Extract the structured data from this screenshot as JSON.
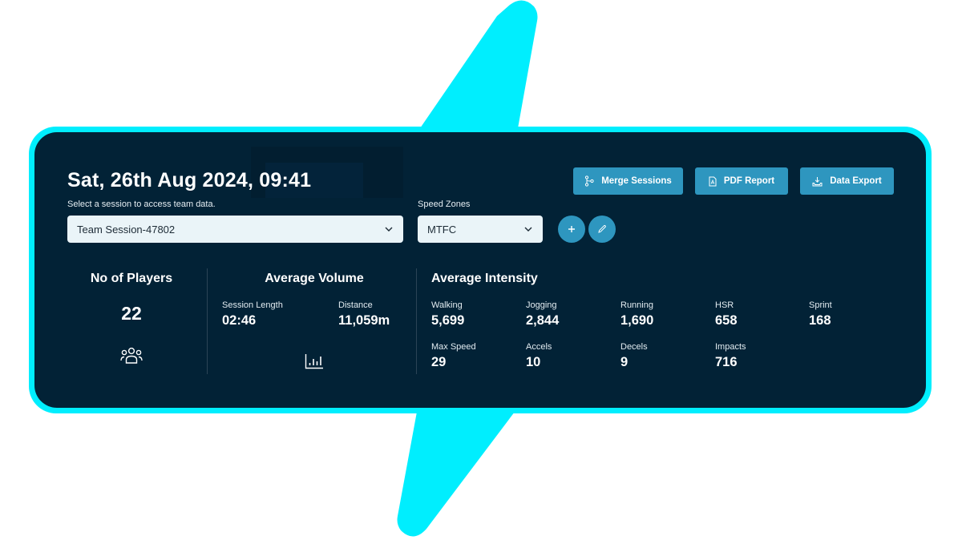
{
  "header": {
    "title": "Sat, 26th Aug 2024, 09:41",
    "subtitle": "Select a session to access team data.",
    "session_select_value": "Team Session-47802",
    "speed_zones_label": "Speed Zones",
    "speed_zones_value": "MTFC"
  },
  "actions": {
    "merge_label": "Merge Sessions",
    "merge_icon": "merge-branch-icon",
    "pdf_label": "PDF Report",
    "pdf_icon": "pdf-file-icon",
    "export_label": "Data Export",
    "export_icon": "download-tray-icon",
    "add_icon": "plus-icon",
    "edit_icon": "pencil-icon"
  },
  "players": {
    "title": "No of Players",
    "value": "22",
    "icon": "users-group-icon"
  },
  "volume": {
    "title": "Average Volume",
    "icon": "bar-chart-icon",
    "metrics": [
      {
        "label": "Session Length",
        "value": "02:46"
      },
      {
        "label": "Distance",
        "value": "11,059m"
      }
    ]
  },
  "intensity": {
    "title": "Average Intensity",
    "metrics": [
      {
        "label": "Walking",
        "value": "5,699"
      },
      {
        "label": "Jogging",
        "value": "2,844"
      },
      {
        "label": "Running",
        "value": "1,690"
      },
      {
        "label": "HSR",
        "value": "658"
      },
      {
        "label": "Sprint",
        "value": "168"
      },
      {
        "label": "Max Speed",
        "value": "29"
      },
      {
        "label": "Accels",
        "value": "10"
      },
      {
        "label": "Decels",
        "value": "9"
      },
      {
        "label": "Impacts",
        "value": "716"
      }
    ]
  },
  "colors": {
    "accent_cyan": "#00eefe",
    "card_bg": "#022236",
    "button_blue": "#2e96bf",
    "input_bg": "#eaf4f8"
  }
}
